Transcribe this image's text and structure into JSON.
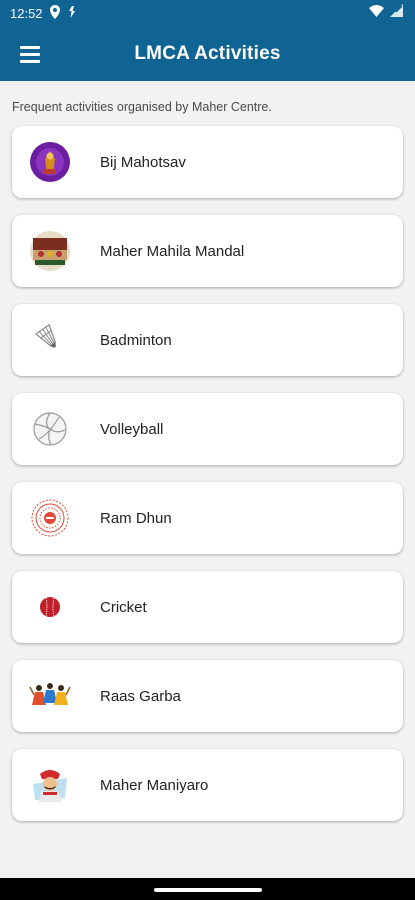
{
  "status_bar": {
    "time": "12:52",
    "icons": [
      "location-icon",
      "data-saver-icon",
      "wifi-icon",
      "signal-icon"
    ]
  },
  "app_bar": {
    "title": "LMCA Activities",
    "menu_icon": "hamburger-menu-icon"
  },
  "subtitle": "Frequent activities organised by Maher Centre.",
  "activities": [
    {
      "label": "Bij Mahotsav",
      "icon": "bij-mahotsav-icon"
    },
    {
      "label": "Maher Mahila Mandal",
      "icon": "mahila-mandal-icon"
    },
    {
      "label": "Badminton",
      "icon": "shuttlecock-icon"
    },
    {
      "label": "Volleyball",
      "icon": "volleyball-icon"
    },
    {
      "label": "Ram Dhun",
      "icon": "ram-dhun-icon"
    },
    {
      "label": "Cricket",
      "icon": "cricket-ball-icon"
    },
    {
      "label": "Raas Garba",
      "icon": "raas-garba-icon"
    },
    {
      "label": "Maher Maniyaro",
      "icon": "maniyaro-icon"
    }
  ],
  "colors": {
    "primary": "#0f6494",
    "background": "#f2f2f2",
    "card": "#ffffff"
  }
}
